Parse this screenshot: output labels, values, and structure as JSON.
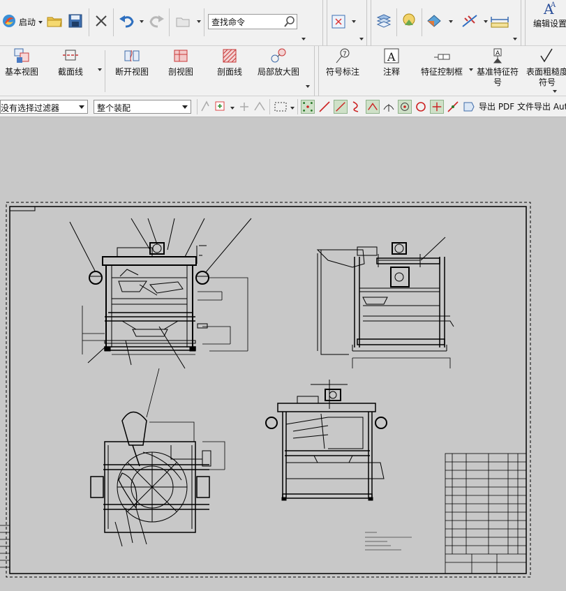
{
  "toolbar_top": {
    "start_label": "启动",
    "search_placeholder": "查找命令",
    "edit_settings_label": "编辑设置"
  },
  "toolbar_views": {
    "items": [
      {
        "label": "基本视图"
      },
      {
        "label": "截面线"
      },
      {
        "label": "断开视图"
      },
      {
        "label": "剖视图"
      },
      {
        "label": "剖面线"
      },
      {
        "label": "局部放大图"
      },
      {
        "label": "符号标注"
      },
      {
        "label": "注释"
      },
      {
        "label": "特征控制框"
      },
      {
        "label": "基准特征符号"
      },
      {
        "label": "表面粗糙度符号"
      }
    ]
  },
  "toolbar_filter": {
    "filter_value": "没有选择过滤器",
    "assembly_value": "整个装配",
    "export_pdf_label": "导出 PDF 文件",
    "export_auto_label": "导出 Auto"
  },
  "drawing": {
    "colors": {
      "line": "#000000",
      "paper": "#c8c8c8",
      "accent": "#cfe1c8"
    }
  }
}
